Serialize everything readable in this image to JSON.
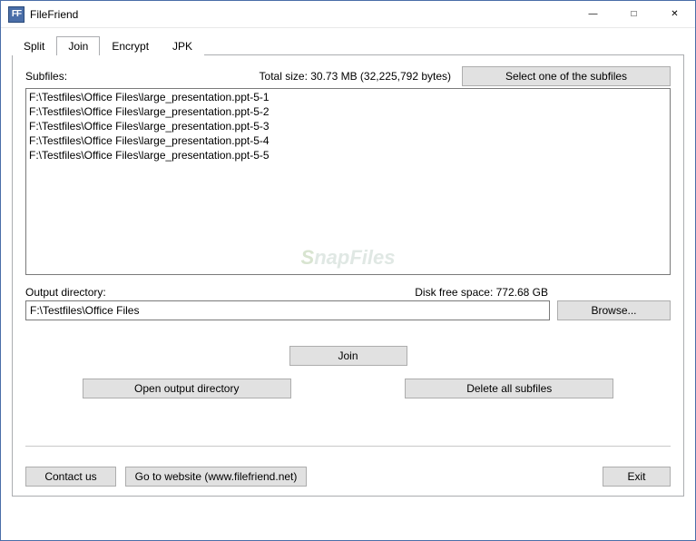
{
  "window": {
    "title": "FileFriend",
    "icon_text": "FF"
  },
  "tabs": {
    "items": [
      "Split",
      "Join",
      "Encrypt",
      "JPK"
    ],
    "active_index": 1
  },
  "subfiles": {
    "label": "Subfiles:",
    "total_size": "Total size: 30.73 MB (32,225,792 bytes)",
    "select_btn": "Select one of the subfiles",
    "items": [
      "F:\\Testfiles\\Office Files\\large_presentation.ppt-5-1",
      "F:\\Testfiles\\Office Files\\large_presentation.ppt-5-2",
      "F:\\Testfiles\\Office Files\\large_presentation.ppt-5-3",
      "F:\\Testfiles\\Office Files\\large_presentation.ppt-5-4",
      "F:\\Testfiles\\Office Files\\large_presentation.ppt-5-5"
    ]
  },
  "output": {
    "label": "Output directory:",
    "disk_free": "Disk free space: 772.68 GB",
    "path": "F:\\Testfiles\\Office Files",
    "browse": "Browse..."
  },
  "actions": {
    "join": "Join",
    "open_output": "Open output directory",
    "delete_all": "Delete all subfiles"
  },
  "footer": {
    "contact": "Contact us",
    "website": "Go to website (www.filefriend.net)",
    "exit": "Exit"
  },
  "watermark": {
    "text": "SnapFiles"
  }
}
